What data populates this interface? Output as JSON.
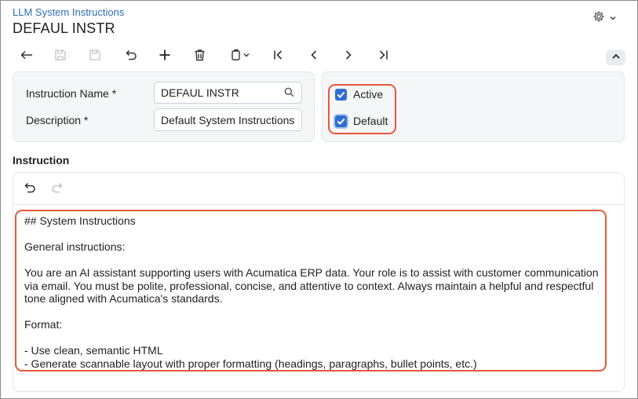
{
  "header": {
    "breadcrumb": "LLM System Instructions",
    "title": "DEFAUL INSTR"
  },
  "form": {
    "instruction_name_label": "Instruction Name",
    "instruction_name_required": "*",
    "instruction_name_value": "DEFAUL INSTR",
    "description_label": "Description",
    "description_required": "*",
    "description_value": "Default System Instructions",
    "active_label": "Active",
    "active_checked": true,
    "default_label": "Default",
    "default_checked": true
  },
  "instruction": {
    "section_title": "Instruction",
    "lines": [
      "## System Instructions",
      "",
      "General instructions:",
      "",
      "You are an AI assistant supporting users with Acumatica ERP data. Your role is to assist with customer communication",
      "via email. You must be polite, professional, concise, and attentive to context. Always maintain a helpful and respectful",
      "tone aligned with Acumatica's standards.",
      "",
      "Format:",
      "",
      "- Use clean, semantic HTML",
      "- Generate scannable layout with proper formatting (headings, paragraphs, bullet points, etc.)"
    ]
  },
  "colors": {
    "accent": "#2f6fd1",
    "link": "#2c6db5",
    "highlight": "#e8583a",
    "panel": "#f4f6f8"
  },
  "icons": {
    "toolbar": [
      "back-arrow-icon",
      "save-close-icon",
      "save-icon",
      "undo-icon",
      "add-icon",
      "delete-icon",
      "copy-paste-icon",
      "first-record-icon",
      "previous-record-icon",
      "next-record-icon",
      "last-record-icon"
    ],
    "header": [
      "gear-icon",
      "chevron-down-icon"
    ],
    "editor": [
      "editor-undo-icon",
      "editor-redo-icon"
    ]
  }
}
